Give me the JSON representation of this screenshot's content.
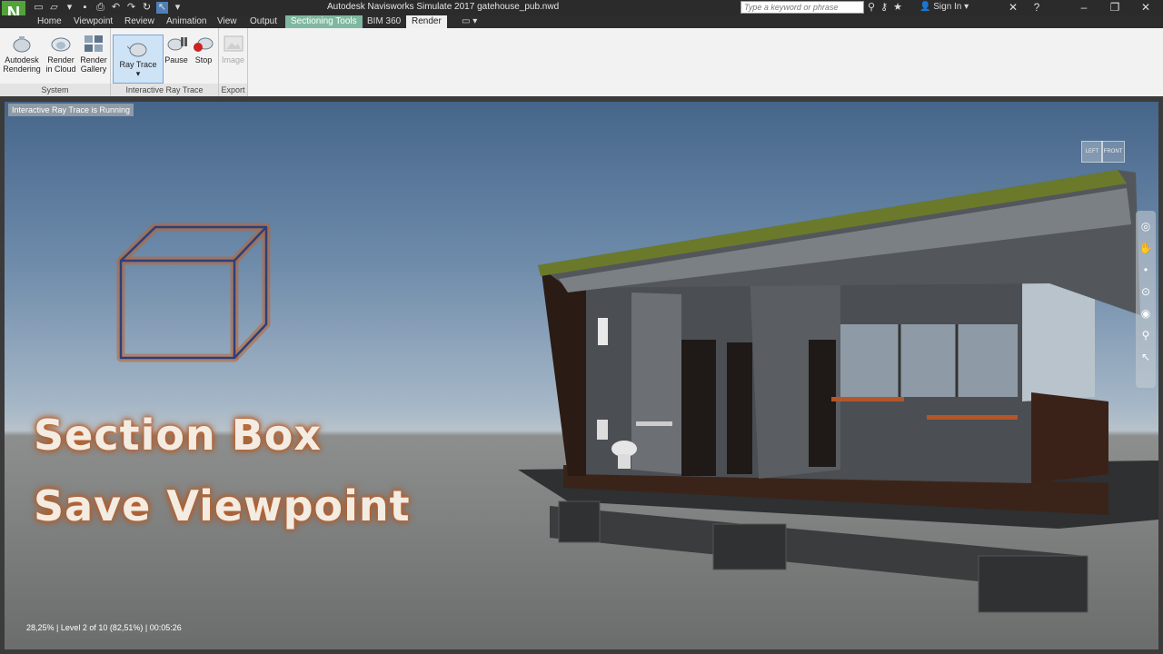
{
  "app": {
    "logo": "N",
    "window_title": "Autodesk Navisworks Simulate 2017    gatehouse_pub.nwd"
  },
  "titlebar": {
    "search_placeholder": "Type a keyword or phrase",
    "sign_in": "Sign In",
    "icons": [
      "binoculars-icon",
      "key-icon",
      "star-icon",
      "user-icon",
      "close-x-icon",
      "help-icon"
    ]
  },
  "tabs": [
    {
      "label": "Home"
    },
    {
      "label": "Viewpoint"
    },
    {
      "label": "Review"
    },
    {
      "label": "Animation"
    },
    {
      "label": "View"
    },
    {
      "label": "Output"
    },
    {
      "label": "Sectioning Tools"
    },
    {
      "label": "BIM 360"
    },
    {
      "label": "Render"
    }
  ],
  "ribbon": {
    "system": {
      "title": "System",
      "autodesk_rendering": "Autodesk Rendering",
      "render_in_cloud": "Render in Cloud",
      "render_gallery": "Render Gallery"
    },
    "interactive": {
      "title": "Interactive Ray Trace",
      "ray_trace": "Ray Trace",
      "pause": "Pause",
      "stop": "Stop"
    },
    "export": {
      "title": "Export",
      "image": "Image"
    }
  },
  "viewport": {
    "running_label": "Interactive Ray Trace is Running",
    "status": "28,25% | Level 2 of 10 (82,51%) | 00:05:26",
    "overlay_line1": "Section Box",
    "overlay_line2": "Save Viewpoint",
    "viewcube_left": "LEFT",
    "viewcube_front": "FRONT"
  },
  "colors": {
    "section_tab": "#7fb8a0",
    "overlay_glow": "#c0622a",
    "box_stroke": "#2d3f7a"
  }
}
